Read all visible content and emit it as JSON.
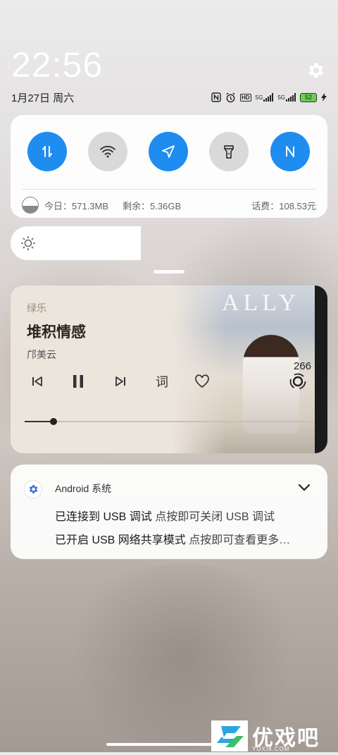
{
  "status": {
    "time": "22:56",
    "date": "1月27日 周六",
    "network": "5G",
    "network2": "5G",
    "hd": "HD",
    "battery": "52"
  },
  "quick_settings": {
    "tiles": [
      {
        "name": "mobile-data",
        "on": true
      },
      {
        "name": "wifi",
        "on": false
      },
      {
        "name": "location",
        "on": true
      },
      {
        "name": "flashlight",
        "on": false
      },
      {
        "name": "nfc",
        "on": true
      }
    ],
    "today_usage": "今日：571.3MB",
    "remaining": "剩余：5.36GB",
    "balance": "话费：108.53元"
  },
  "brightness": {
    "level": 0.41
  },
  "music": {
    "app": "绿乐",
    "title": "堆积情感",
    "artist": "邝美云",
    "lyrics_label": "词",
    "album_text": "ALLY",
    "album_number": "266",
    "progress": 0.1
  },
  "notification": {
    "source": "Android 系统",
    "line1_title": "已连接到 USB 调试",
    "line1_sub": " 点按即可关闭 USB 调试",
    "line2_title": "已开启 USB 网络共享模式",
    "line2_sub": " 点按即可查看更多…"
  },
  "watermark": {
    "text": "优戏吧",
    "url": "YOXI8.COM"
  }
}
